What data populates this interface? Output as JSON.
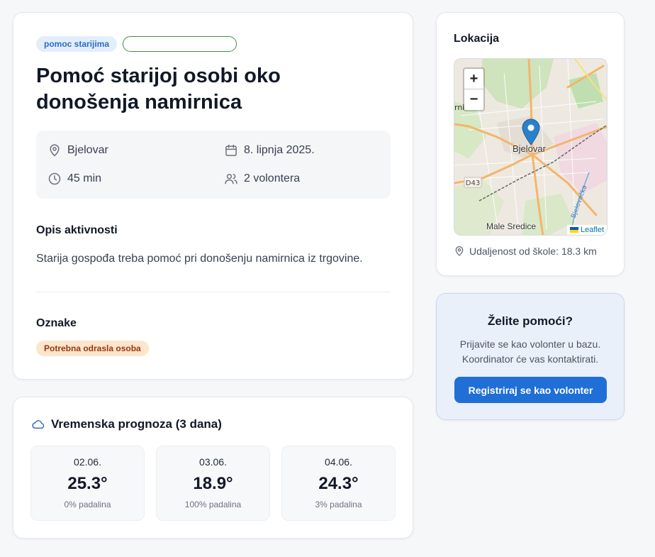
{
  "activity": {
    "category_badge": "pomoc starijima",
    "status_badge": "",
    "title": "Pomoć starijoj osobi oko donošenja namirnica",
    "location": "Bjelovar",
    "date": "8. lipnja 2025.",
    "duration": "45 min",
    "volunteers": "2 volontera"
  },
  "description": {
    "heading": "Opis aktivnosti",
    "text": "Starija gospođa treba pomoć pri donošenju namirnica iz trgovine."
  },
  "tags": {
    "heading": "Oznake",
    "items": [
      "Potrebna odrasla osoba"
    ]
  },
  "weather": {
    "heading": "Vremenska prognoza (3 dana)",
    "days": [
      {
        "date": "02.06.",
        "temp": "25.3°",
        "rain": "0% padalina"
      },
      {
        "date": "03.06.",
        "temp": "18.9°",
        "rain": "100% padalina"
      },
      {
        "date": "04.06.",
        "temp": "24.3°",
        "rain": "3% padalina"
      }
    ]
  },
  "location": {
    "heading": "Lokacija",
    "map": {
      "zoom_in": "+",
      "zoom_out": "−",
      "city_label": "Bjelovar",
      "road_label": "D43",
      "village_label": "Male Sredice",
      "partial_label": "rni",
      "river_label": "Bjelovačka",
      "attribution": "Leaflet"
    },
    "distance": "Udaljenost od škole: 18.3 km"
  },
  "cta": {
    "title": "Želite pomoći?",
    "text_line1": "Prijavite se kao volonter u bazu.",
    "text_line2": "Koordinator će vas kontaktirati.",
    "button": "Registriraj se kao volonter"
  },
  "colors": {
    "accent": "#1f6fd6",
    "category_badge_bg": "#e3eefb",
    "status_badge_border": "#3b9142",
    "tag_bg": "#fde6cc",
    "marker": "#2a81cb"
  },
  "icons": [
    "map-pin-icon",
    "calendar-icon",
    "clock-icon",
    "users-icon",
    "cloud-icon",
    "map-marker-icon",
    "ukraine-flag-icon"
  ]
}
